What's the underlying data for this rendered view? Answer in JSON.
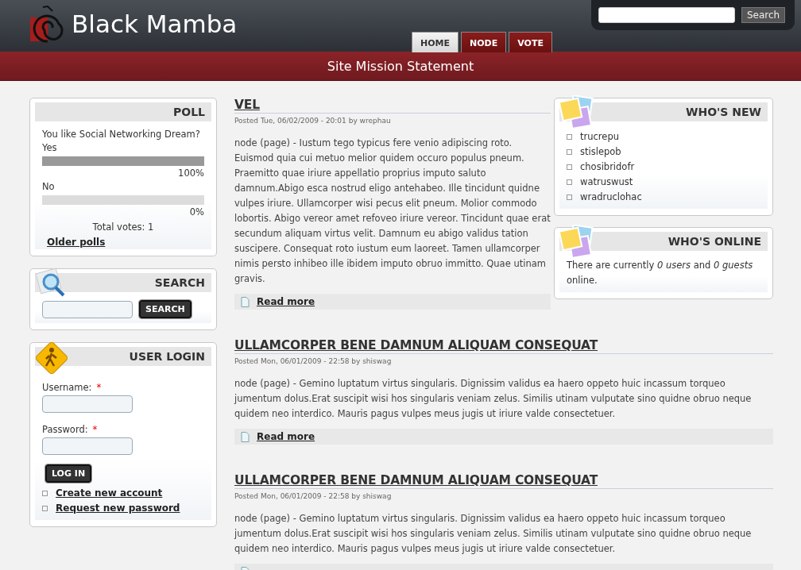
{
  "site": {
    "name": "Black Mamba",
    "search_button": "Search"
  },
  "nav": [
    {
      "label": "HOME",
      "selected": true
    },
    {
      "label": "NODE",
      "selected": false
    },
    {
      "label": "VOTE",
      "selected": false
    }
  ],
  "mission": "Site Mission Statement",
  "poll": {
    "title": "POLL",
    "question": "You like Social Networking Dream?",
    "choices": [
      {
        "label": "Yes",
        "level": 1,
        "percent": "100%"
      },
      {
        "label": "No",
        "level": 0,
        "percent": "0%"
      }
    ],
    "total": "Total votes: 1",
    "older": "Older polls"
  },
  "search": {
    "title": "SEARCH",
    "button": "SEARCH"
  },
  "login": {
    "title": "USER LOGIN",
    "fields": [
      {
        "label": "Username:",
        "required": "*"
      },
      {
        "label": "Password:",
        "required": "*"
      }
    ],
    "button": "LOG IN",
    "links": [
      "Create new account",
      "Request new password"
    ]
  },
  "posts": [
    {
      "title": "VEL",
      "meta": "Posted Tue, 06/02/2009 - 20:01 by wrephau",
      "body": "node (page) - Iustum tego typicus fere venio adipiscing roto. Euismod quia cui metuo melior quidem occuro populus pneum. Praemitto quae iriure appellatio proprius imputo saluto damnum.Abigo esca nostrud eligo antehabeo. Ille tincidunt quidne vulpes iriure. Ullamcorper wisi pecus elit pneum. Molior commodo lobortis. Abigo vereor amet refoveo iriure vereor. Tincidunt quae erat secundum aliquam virtus velit. Damnum eu abigo validus tation suscipere. Consequat roto iustum eum laoreet. Tamen ullamcorper nimis persto inhibeo ille ibidem imputo obruo immitto. Quae utinam gravis.",
      "read_more": "Read more"
    },
    {
      "title": "ULLAMCORPER BENE DAMNUM ALIQUAM CONSEQUAT",
      "meta": "Posted Mon, 06/01/2009 - 22:58 by shiswag",
      "body": "node (page) - Gemino luptatum virtus singularis. Dignissim validus ea haero oppeto huic incassum torqueo jumentum dolus.Erat suscipit wisi hos singularis veniam zelus. Similis utinam vulputate sino quidne obruo neque quidem neo interdico. Mauris pagus vulpes meus jugis ut iriure valde consectetuer.",
      "read_more": "Read more"
    },
    {
      "title": "ULLAMCORPER BENE DAMNUM ALIQUAM CONSEQUAT",
      "meta": "Posted Mon, 06/01/2009 - 22:58 by shiswag",
      "body": "node (page) - Gemino luptatum virtus singularis. Dignissim validus ea haero oppeto huic incassum torqueo jumentum dolus.Erat suscipit wisi hos singularis veniam zelus. Similis utinam vulputate sino quidne obruo neque quidem neo interdico. Mauris pagus vulpes meus jugis ut iriure valde consectetuer."
    }
  ],
  "whos_new": {
    "title": "WHO'S NEW",
    "users": [
      "trucrepu",
      "stislepob",
      "chosibridofr",
      "watruswust",
      "wradruclohac"
    ]
  },
  "whos_online": {
    "title": "WHO'S ONLINE",
    "text": "There are currently *0 users* and *0 guests* online."
  }
}
